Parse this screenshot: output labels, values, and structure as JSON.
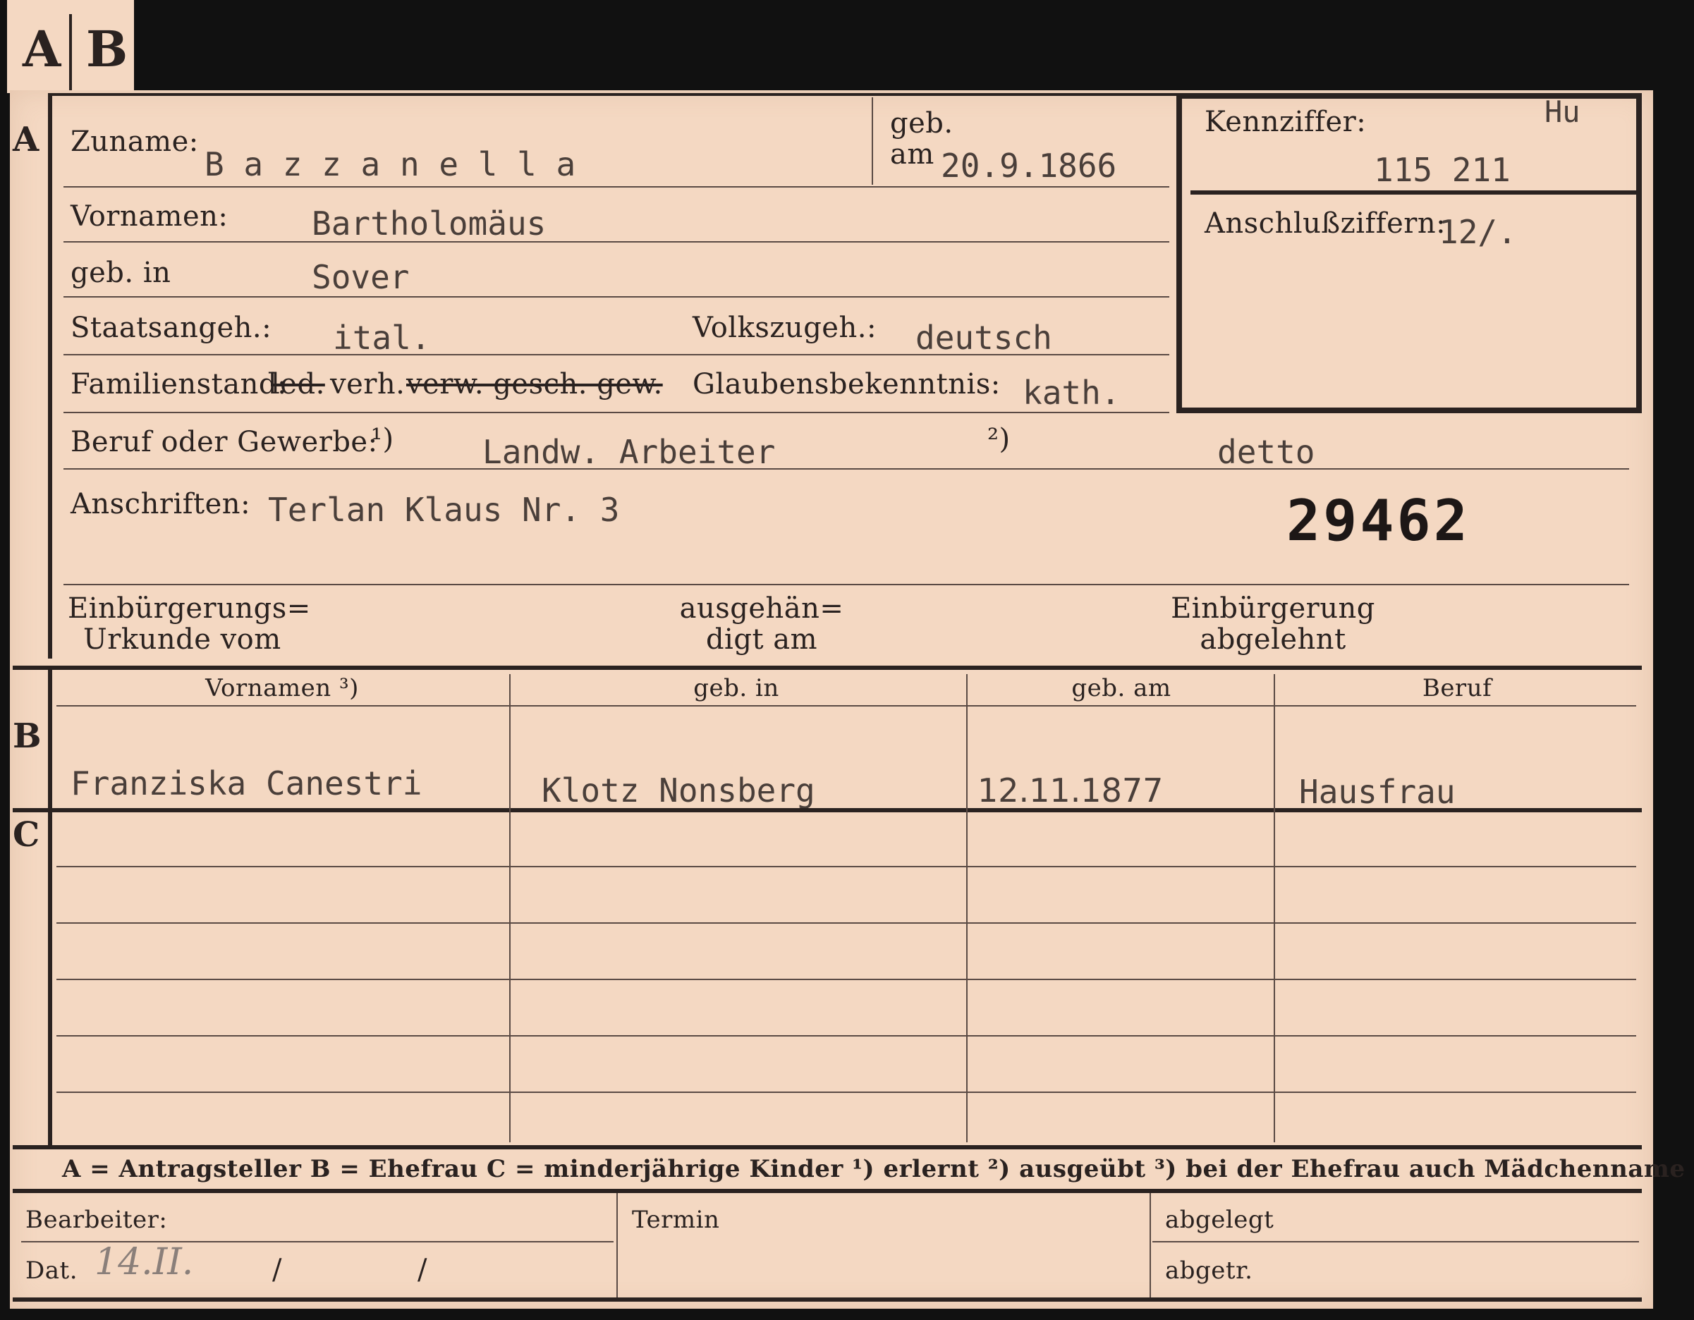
{
  "tabs": {
    "a": "A",
    "b": "B"
  },
  "section_a": {
    "marker": "A",
    "zuname": {
      "label": "Zuname:",
      "value": "B a z z a n e l l a"
    },
    "geb_am": {
      "label_top": "geb.",
      "label_bottom": "am",
      "value": "20.9.1866"
    },
    "vornamen": {
      "label": "Vornamen:",
      "value": "Bartholomäus"
    },
    "geb_in": {
      "label": "geb. in",
      "value": "Sover"
    },
    "staatsangeh": {
      "label": "Staatsangeh.:",
      "value": "ital."
    },
    "volkszugeh": {
      "label": "Volkszugeh.:",
      "value": "deutsch"
    },
    "familienstand": {
      "label": "Familienstand:",
      "opt_ledig": "led.",
      "opt_verh": "verh.",
      "opt_rest": "verw. gesch. gew."
    },
    "glaubensbekenntnis": {
      "label": "Glaubensbekenntnis:",
      "value": "kath."
    },
    "beruf": {
      "label": "Beruf oder Gewerbe:",
      "mark1": "¹)",
      "value1": "Landw. Arbeiter",
      "mark2": "²)",
      "value2": "detto"
    },
    "anschriften": {
      "label": "Anschriften:",
      "value": "Terlan Klaus Nr. 3"
    },
    "stamp_number": "29462",
    "einbuergerungs_urkunde": {
      "line1": "Einbürgerungs=",
      "line2": "Urkunde vom"
    },
    "ausgehaendigt": {
      "line1": "ausgehän=",
      "line2": "digt am"
    },
    "einbuergerung_abgelehnt": {
      "line1": "Einbürgerung",
      "line2": "abgelehnt"
    }
  },
  "kennziffer": {
    "label": "Kennziffer:",
    "code": "Hu",
    "value": "115 211"
  },
  "anschlussziffern": {
    "label": "Anschlußziffern:",
    "value": "12/."
  },
  "section_b": {
    "marker": "B",
    "headers": [
      "Vornamen ³)",
      "geb. in",
      "geb. am",
      "Beruf"
    ],
    "row": [
      "Franziska Canestri",
      "Klotz Nonsberg",
      "12.11.1877",
      "Hausfrau"
    ]
  },
  "section_c": {
    "marker": "C"
  },
  "legend": "A = Antragsteller   B = Ehefrau   C = minderjährige Kinder   ¹) erlernt   ²) ausgeübt   ³) bei der Ehefrau auch Mädchenname",
  "footer": {
    "bearbeiter": "Bearbeiter:",
    "termin": "Termin",
    "abgelegt": "abgelegt",
    "dat_label": "Dat.",
    "dat_value": "14.II.",
    "dat_sep1": "/",
    "dat_sep2": "/",
    "abgetr": "abgetr."
  }
}
